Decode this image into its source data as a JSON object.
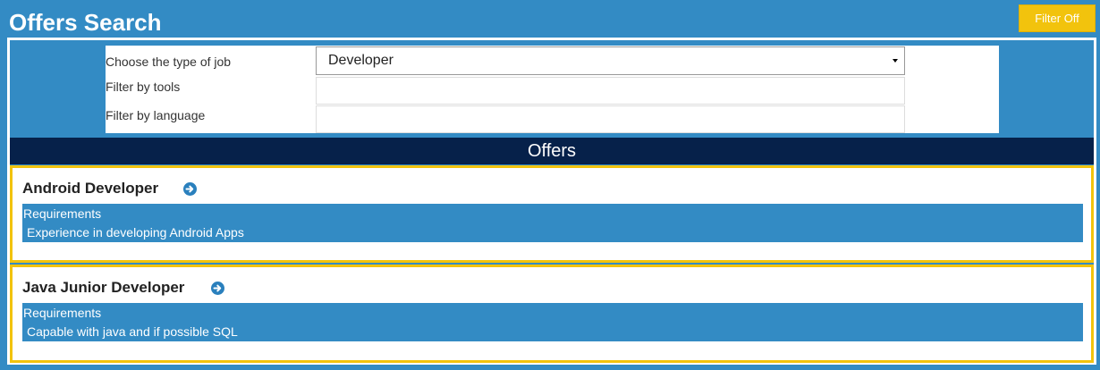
{
  "page": {
    "title": "Offers Search",
    "filter_off_label": "Filter Off"
  },
  "filters": {
    "job_type_label": "Choose the type of job",
    "job_type_value": "Developer",
    "tools_label": "Filter by tools",
    "tools_value": "",
    "language_label": "Filter by language",
    "language_value": ""
  },
  "offers": {
    "header": "Offers",
    "items": [
      {
        "title": "Android Developer",
        "requirements_label": "Requirements",
        "requirements_text": "Experience in developing Android Apps"
      },
      {
        "title": "Java Junior Developer",
        "requirements_label": "Requirements",
        "requirements_text": "Capable with java and if possible SQL"
      }
    ]
  },
  "colors": {
    "background": "#338bc4",
    "offers_header": "#06214a",
    "accent": "#f2c30d",
    "arrow": "#2a80bd"
  },
  "icons": {
    "arrow": "arrow-circle-right-icon",
    "dropdown": "caret-down-icon"
  }
}
